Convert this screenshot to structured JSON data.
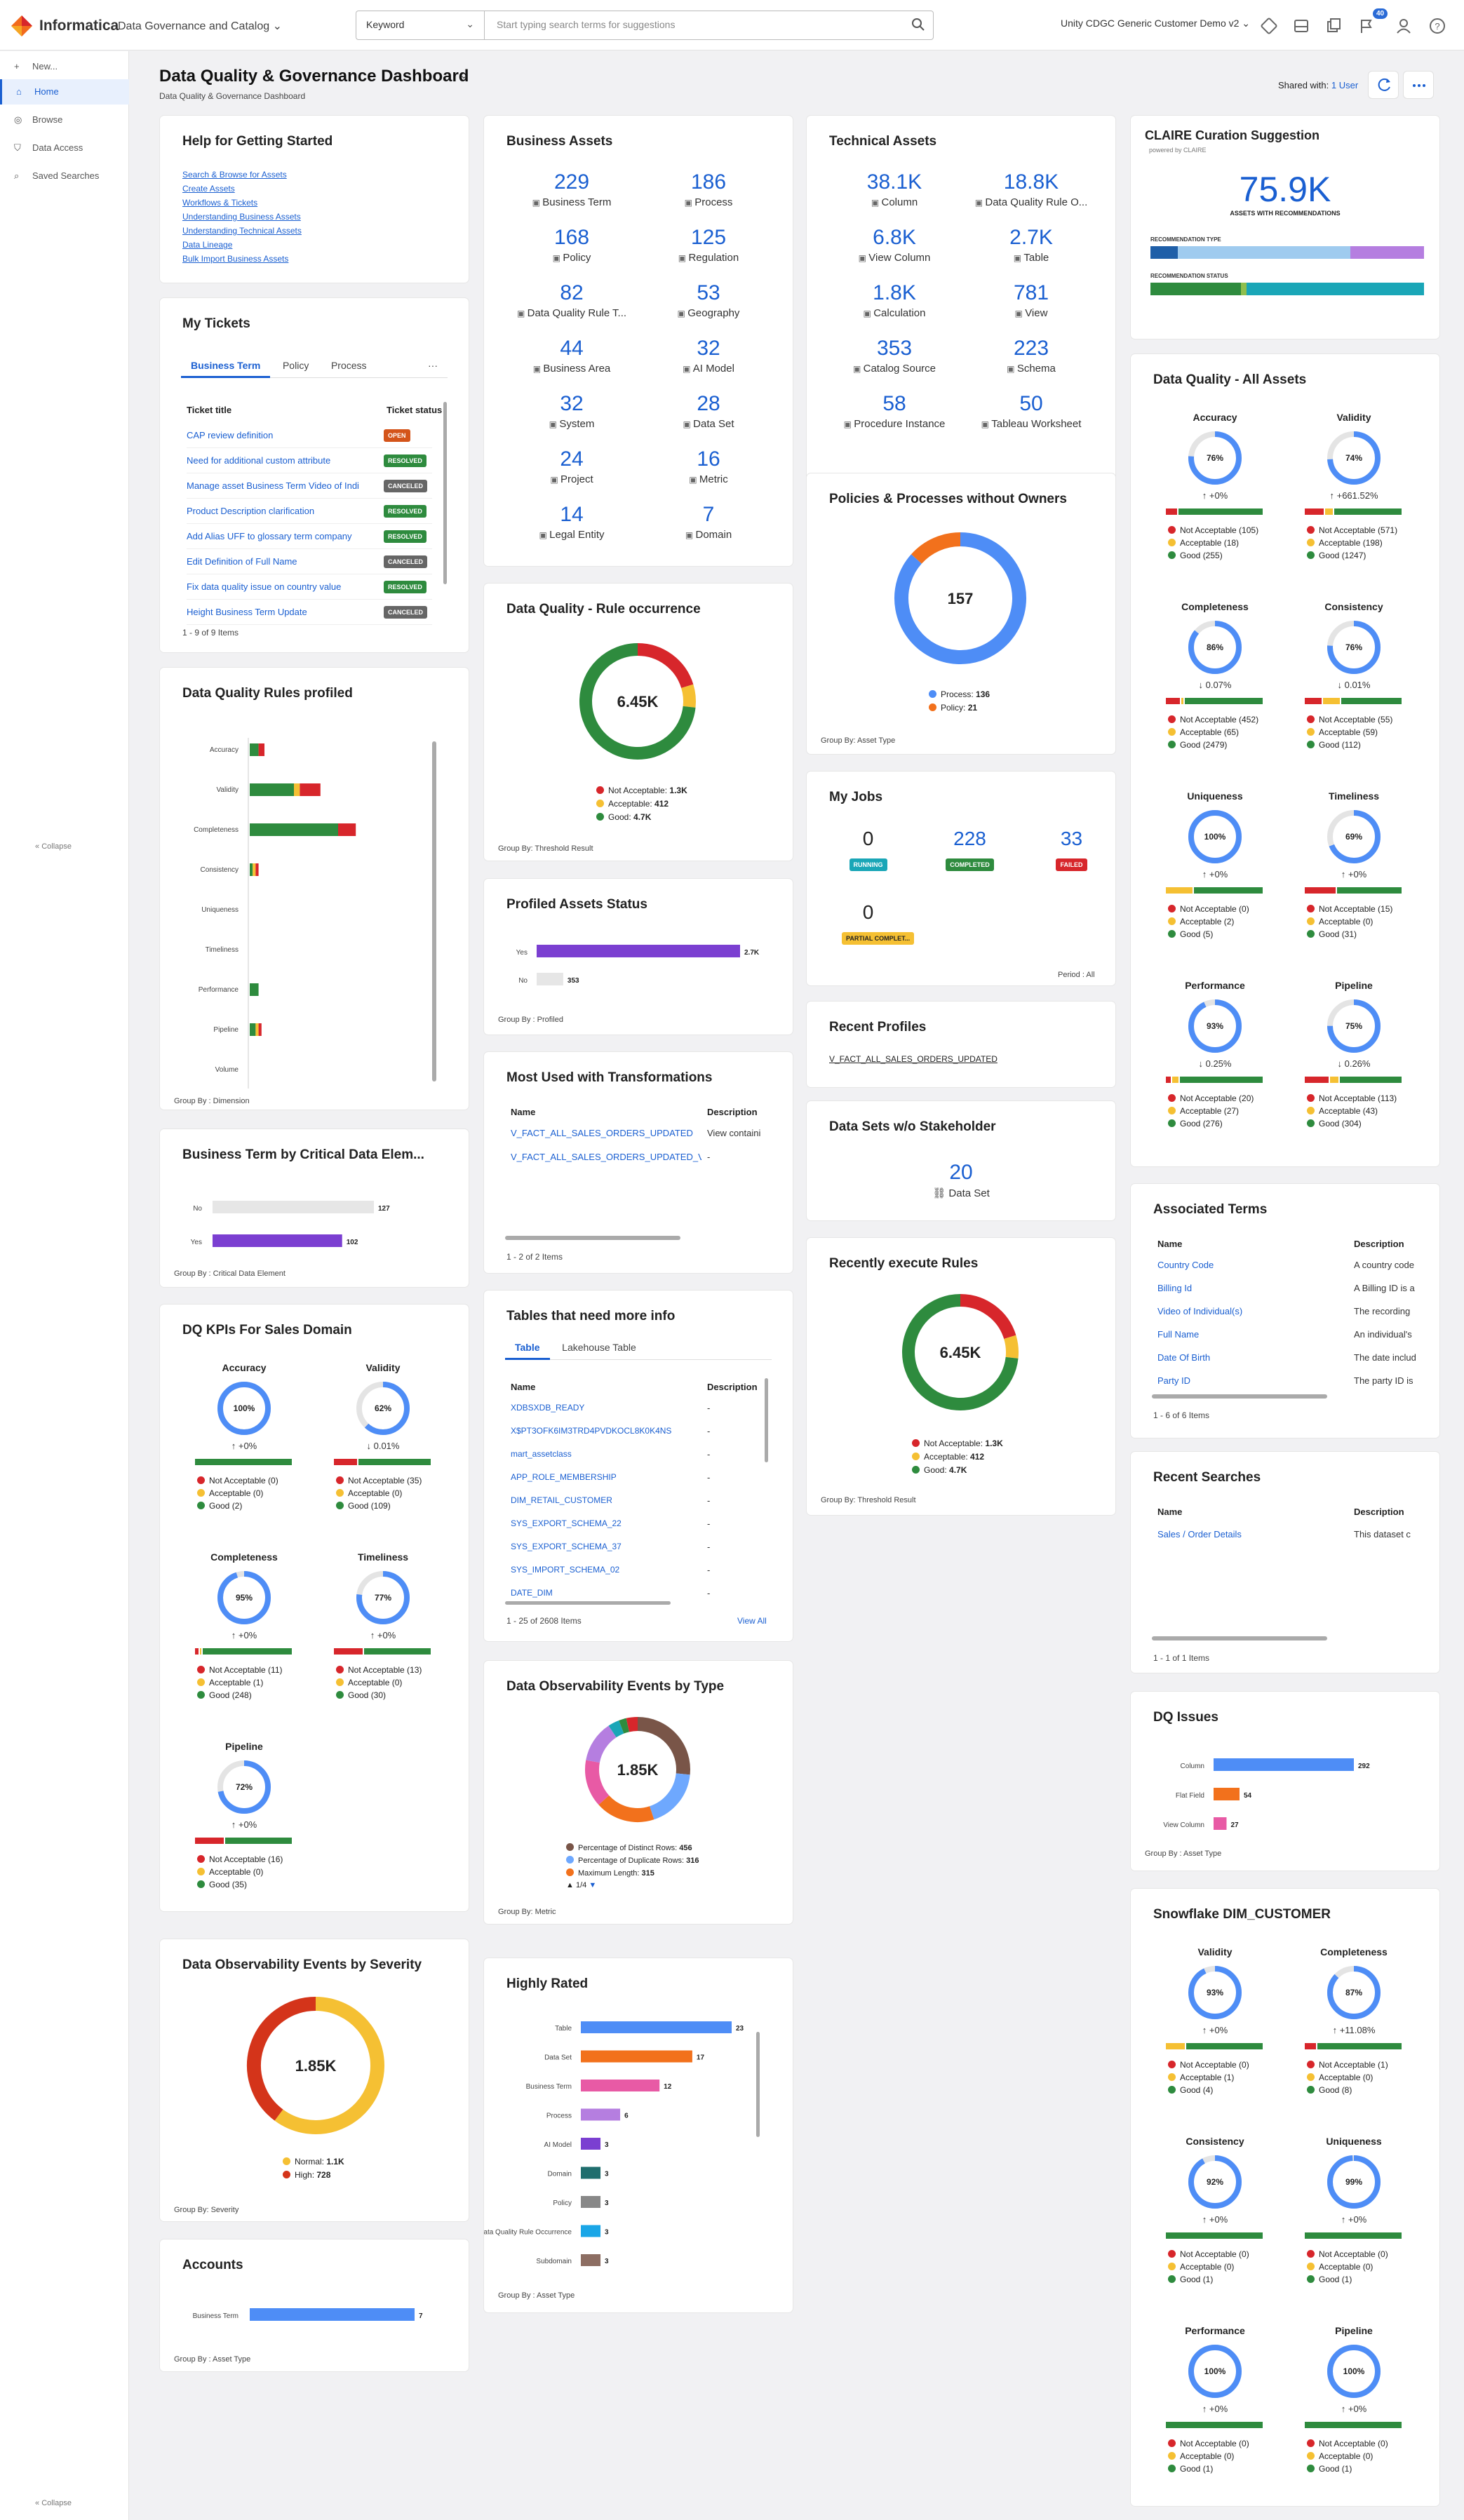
{
  "app": {
    "brand": "Informatica",
    "product": "Data Governance and Catalog",
    "search_type": "Keyword",
    "search_placeholder": "Start typing search terms for suggestions",
    "org": "Unity CDGC Generic Customer Demo v2",
    "notifications": "40"
  },
  "sidebar": {
    "items": [
      {
        "label": "New..."
      },
      {
        "label": "Home"
      },
      {
        "label": "Browse"
      },
      {
        "label": "Data Access"
      },
      {
        "label": "Saved Searches"
      }
    ],
    "collapse1": "Collapse",
    "collapse2": "Collapse"
  },
  "page": {
    "title": "Data Quality & Governance Dashboard",
    "subtitle": "Data Quality & Governance Dashboard",
    "shared_label": "Shared with:",
    "shared_value": "1 User"
  },
  "help": {
    "title": "Help for Getting Started",
    "links": [
      "Search & Browse for Assets",
      "Create Assets",
      "Workflows & Tickets",
      "Understanding Business Assets",
      "Understanding Technical Assets",
      "Data Lineage",
      "Bulk Import Business Assets"
    ]
  },
  "tickets": {
    "title": "My Tickets",
    "tabs": [
      "Business Term",
      "Policy",
      "Process"
    ],
    "more": "···",
    "col1": "Ticket title",
    "col2": "Ticket status",
    "rows": [
      {
        "t": "CAP review definition",
        "s": "OPEN",
        "c": "#d4541a"
      },
      {
        "t": "Need for additional custom attribute",
        "s": "RESOLVED",
        "c": "#2e8b3e"
      },
      {
        "t": "Manage asset Business Term Video of Indi",
        "s": "CANCELED",
        "c": "#666"
      },
      {
        "t": "Product Description clarification",
        "s": "RESOLVED",
        "c": "#2e8b3e"
      },
      {
        "t": "Add Alias UFF to glossary term company",
        "s": "RESOLVED",
        "c": "#2e8b3e"
      },
      {
        "t": "Edit Definition of Full Name",
        "s": "CANCELED",
        "c": "#666"
      },
      {
        "t": "Fix data quality issue on country value",
        "s": "RESOLVED",
        "c": "#2e8b3e"
      },
      {
        "t": "Height Business Term Update",
        "s": "CANCELED",
        "c": "#666"
      }
    ],
    "items": "1 - 9 of 9 Items"
  },
  "business_assets": {
    "title": "Business Assets",
    "items": [
      {
        "v": "229",
        "l": "Business Term"
      },
      {
        "v": "186",
        "l": "Process"
      },
      {
        "v": "168",
        "l": "Policy"
      },
      {
        "v": "125",
        "l": "Regulation"
      },
      {
        "v": "82",
        "l": "Data Quality Rule T..."
      },
      {
        "v": "53",
        "l": "Geography"
      },
      {
        "v": "44",
        "l": "Business Area"
      },
      {
        "v": "32",
        "l": "AI Model"
      },
      {
        "v": "32",
        "l": "System"
      },
      {
        "v": "28",
        "l": "Data Set"
      },
      {
        "v": "24",
        "l": "Project"
      },
      {
        "v": "16",
        "l": "Metric"
      },
      {
        "v": "14",
        "l": "Legal Entity"
      },
      {
        "v": "7",
        "l": "Domain"
      }
    ]
  },
  "technical_assets": {
    "title": "Technical Assets",
    "items": [
      {
        "v": "38.1K",
        "l": "Column"
      },
      {
        "v": "18.8K",
        "l": "Data Quality Rule O..."
      },
      {
        "v": "6.8K",
        "l": "View Column"
      },
      {
        "v": "2.7K",
        "l": "Table"
      },
      {
        "v": "1.8K",
        "l": "Calculation"
      },
      {
        "v": "781",
        "l": "View"
      },
      {
        "v": "353",
        "l": "Catalog Source"
      },
      {
        "v": "223",
        "l": "Schema"
      },
      {
        "v": "58",
        "l": "Procedure Instance"
      },
      {
        "v": "50",
        "l": "Tableau Worksheet"
      }
    ]
  },
  "claire": {
    "title": "CLAIRE Curation Suggestion",
    "powered": "powered by CLAIRE",
    "value": "75.9K",
    "caption": "ASSETS WITH RECOMMENDATIONS",
    "type_label": "RECOMMENDATION TYPE",
    "status_label": "RECOMMENDATION STATUS"
  },
  "dq_rules_profiled": {
    "title": "Data Quality Rules profiled",
    "group_by": "Group By : Dimension"
  },
  "dq_rule_occurrence": {
    "title": "Data Quality - Rule occurrence",
    "center": "6.45K",
    "group_by": "Group By: Threshold Result"
  },
  "policies_owners": {
    "title": "Policies & Processes without Owners",
    "center": "157",
    "group_by": "Group By: Asset Type"
  },
  "my_jobs": {
    "title": "My Jobs",
    "period": "Period : All",
    "jobs": [
      {
        "v": "0",
        "l": "RUNNING",
        "c": "#1aa6b7"
      },
      {
        "v": "228",
        "l": "COMPLETED",
        "c": "#2e8b3e"
      },
      {
        "v": "33",
        "l": "FAILED",
        "c": "#d7262b"
      },
      {
        "v": "0",
        "l": "PARTIAL COMPLET...",
        "c": "#f5c033"
      }
    ]
  },
  "profiled_status": {
    "title": "Profiled Assets Status",
    "group_by": "Group By : Profiled"
  },
  "recent_profiles": {
    "title": "Recent Profiles",
    "item": "V_FACT_ALL_SALES_ORDERS_UPDATED"
  },
  "most_used": {
    "title": "Most Used with Transformations",
    "col1": "Name",
    "col2": "Description",
    "rows": [
      {
        "n": "V_FACT_ALL_SALES_ORDERS_UPDATED",
        "d": "View containi"
      },
      {
        "n": "V_FACT_ALL_SALES_ORDERS_UPDATED_V",
        "d": "-"
      }
    ],
    "items": "1 - 2 of 2 Items"
  },
  "datasets_stakeholder": {
    "title": "Data Sets w/o Stakeholder",
    "value": "20",
    "label": "Data Set"
  },
  "bt_critical": {
    "title": "Business Term by Critical Data Elem...",
    "group_by": "Group By : Critical Data Element"
  },
  "tables_info": {
    "title": "Tables that need more info",
    "tabs": [
      "Table",
      "Lakehouse Table"
    ],
    "col1": "Name",
    "col2": "Description",
    "rows": [
      "XDBSXDB_READY",
      "X$PT3OFK6IM3TRD4PVDKOCL8K0K4NS",
      "mart_assetclass",
      "APP_ROLE_MEMBERSHIP",
      "DIM_RETAIL_CUSTOMER",
      "SYS_EXPORT_SCHEMA_22",
      "SYS_EXPORT_SCHEMA_37",
      "SYS_IMPORT_SCHEMA_02",
      "DATE_DIM"
    ],
    "dash": "-",
    "items": "1 - 25 of 2608 Items",
    "view_all": "View All"
  },
  "recent_rules": {
    "title": "Recently execute Rules",
    "center": "6.45K",
    "group_by": "Group By: Threshold Result"
  },
  "dq_all": {
    "title": "Data Quality - All Assets"
  },
  "assoc_terms": {
    "title": "Associated Terms",
    "col1": "Name",
    "col2": "Description",
    "rows": [
      {
        "n": "Country Code",
        "d": "A country code"
      },
      {
        "n": "Billing Id",
        "d": "A Billing ID is a"
      },
      {
        "n": "Video of Individual(s)",
        "d": "The recording"
      },
      {
        "n": "Full Name",
        "d": "An individual's"
      },
      {
        "n": "Date Of Birth",
        "d": "The date includ"
      },
      {
        "n": "Party ID",
        "d": "The party ID is"
      }
    ],
    "items": "1 - 6 of 6 Items"
  },
  "recent_searches": {
    "title": "Recent Searches",
    "col1": "Name",
    "col2": "Description",
    "rows": [
      {
        "n": "Sales / Order Details",
        "d": "This dataset c"
      }
    ],
    "items": "1 - 1 of 1 Items"
  },
  "dq_kpis": {
    "title": "DQ KPIs For Sales Domain"
  },
  "obs_type": {
    "title": "Data Observability Events by Type",
    "center": "1.85K",
    "group_by": "Group By: Metric",
    "pager": "1/4"
  },
  "dq_issues": {
    "title": "DQ Issues",
    "group_by": "Group By : Asset Type"
  },
  "snowflake": {
    "title": "Snowflake DIM_CUSTOMER"
  },
  "obs_severity": {
    "title": "Data Observability Events by Severity",
    "center": "1.85K",
    "group_by": "Group By: Severity"
  },
  "highly_rated": {
    "title": "Highly Rated",
    "group_by": "Group By : Asset Type"
  },
  "accounts": {
    "title": "Accounts",
    "group_by": "Group By : Asset Type"
  },
  "chart_data": [
    {
      "id": "dq_rules_profiled",
      "type": "bar",
      "orientation": "horizontal",
      "stacked": true,
      "categories": [
        "Accuracy",
        "Validity",
        "Completeness",
        "Consistency",
        "Uniqueness",
        "Timeliness",
        "Performance",
        "Pipeline",
        "Volume"
      ],
      "series": [
        {
          "color": "#2e8b3e",
          "values": [
            3,
            15,
            30,
            1,
            0,
            0,
            3,
            2,
            0
          ]
        },
        {
          "color": "#f5c033",
          "values": [
            0,
            2,
            0,
            1,
            0,
            0,
            0,
            1,
            0
          ]
        },
        {
          "color": "#d7262b",
          "values": [
            2,
            7,
            6,
            1,
            0,
            0,
            0,
            1,
            0
          ]
        }
      ]
    },
    {
      "id": "dq_rule_occurrence",
      "type": "pie",
      "donut": true,
      "slices": [
        {
          "label": "Not Acceptable",
          "value_text": "1.3K",
          "value": 1300,
          "color": "#d7262b"
        },
        {
          "label": "Acceptable",
          "value_text": "412",
          "value": 412,
          "color": "#f5c033"
        },
        {
          "label": "Good",
          "value_text": "4.7K",
          "value": 4700,
          "color": "#2e8b3e"
        }
      ]
    },
    {
      "id": "policies_owners",
      "type": "pie",
      "donut": true,
      "slices": [
        {
          "label": "Process",
          "value": 136,
          "color": "#4e8df6"
        },
        {
          "label": "Policy",
          "value": 21,
          "color": "#f2711c"
        }
      ]
    },
    {
      "id": "profiled_status",
      "type": "bar",
      "orientation": "horizontal",
      "categories": [
        "Yes",
        "No"
      ],
      "values": [
        2700,
        353
      ],
      "labels": [
        "2.7K",
        "353"
      ],
      "colors": [
        "#7b3fd1",
        "#e6e6e6"
      ]
    },
    {
      "id": "bt_critical",
      "type": "bar",
      "orientation": "horizontal",
      "categories": [
        "No",
        "Yes"
      ],
      "values": [
        127,
        102
      ],
      "colors": [
        "#e6e6e6",
        "#7b3fd1"
      ]
    },
    {
      "id": "recent_rules",
      "type": "pie",
      "donut": true,
      "slices": [
        {
          "label": "Not Acceptable",
          "value_text": "1.3K",
          "value": 1300,
          "color": "#d7262b"
        },
        {
          "label": "Acceptable",
          "value_text": "412",
          "value": 412,
          "color": "#f5c033"
        },
        {
          "label": "Good",
          "value_text": "4.7K",
          "value": 4700,
          "color": "#2e8b3e"
        }
      ]
    },
    {
      "id": "obs_type",
      "type": "pie",
      "donut": true,
      "legend": [
        {
          "label": "Percentage of Distinct Rows",
          "value": 456,
          "color": "#795548"
        },
        {
          "label": "Percentage of Duplicate Rows",
          "value": 316,
          "color": "#6ea8fe"
        },
        {
          "label": "Maximum Length",
          "value": 315,
          "color": "#f2711c"
        }
      ],
      "slices": [
        {
          "value": 456,
          "color": "#795548"
        },
        {
          "value": 316,
          "color": "#6ea8fe"
        },
        {
          "value": 315,
          "color": "#f2711c"
        },
        {
          "value": 250,
          "color": "#e85aa5"
        },
        {
          "value": 220,
          "color": "#b57ee0"
        },
        {
          "value": 60,
          "color": "#1aa6b7"
        },
        {
          "value": 40,
          "color": "#2e8b3e"
        },
        {
          "value": 60,
          "color": "#d7262b"
        }
      ]
    },
    {
      "id": "obs_severity",
      "type": "pie",
      "donut": true,
      "slices": [
        {
          "label": "Normal",
          "value_text": "1.1K",
          "value": 1100,
          "color": "#f5c033"
        },
        {
          "label": "High",
          "value": 728,
          "color": "#d4341a"
        }
      ]
    },
    {
      "id": "dq_issues",
      "type": "bar",
      "orientation": "horizontal",
      "categories": [
        "Column",
        "Flat Field",
        "View Column"
      ],
      "values": [
        292,
        54,
        27
      ],
      "colors": [
        "#4e8df6",
        "#f2711c",
        "#e85aa5"
      ]
    },
    {
      "id": "highly_rated",
      "type": "bar",
      "orientation": "horizontal",
      "categories": [
        "Table",
        "Data Set",
        "Business Term",
        "Process",
        "AI Model",
        "Domain",
        "Policy",
        "Data Quality Rule Occurrence",
        "Subdomain"
      ],
      "values": [
        23,
        17,
        12,
        6,
        3,
        3,
        3,
        3,
        3
      ],
      "colors": [
        "#4e8df6",
        "#f2711c",
        "#e85aa5",
        "#b57ee0",
        "#7b3fd1",
        "#1f6e6e",
        "#888888",
        "#1aa6e7",
        "#8d6e63"
      ]
    },
    {
      "id": "accounts",
      "type": "bar",
      "orientation": "horizontal",
      "categories": [
        "Business Term"
      ],
      "values": [
        7
      ],
      "colors": [
        "#4e8df6"
      ]
    }
  ],
  "dq_all_items": [
    {
      "name": "Accuracy",
      "pct": 76,
      "delta": "↑ +0%",
      "bar": [
        12,
        0,
        88
      ],
      "na": 105,
      "ac": 18,
      "gd": 255
    },
    {
      "name": "Validity",
      "pct": 74,
      "delta": "↑ +661.52%",
      "bar": [
        20,
        8,
        72
      ],
      "na": 571,
      "ac": 198,
      "gd": 1247
    },
    {
      "name": "Completeness",
      "pct": 86,
      "delta": "↓ 0.07%",
      "bar": [
        15,
        2,
        83
      ],
      "na": 452,
      "ac": 65,
      "gd": 2479
    },
    {
      "name": "Consistency",
      "pct": 76,
      "delta": "↓ 0.01%",
      "bar": [
        18,
        18,
        64
      ],
      "na": 55,
      "ac": 59,
      "gd": 112
    },
    {
      "name": "Uniqueness",
      "pct": 100,
      "delta": "↑ +0%",
      "bar": [
        0,
        28,
        72
      ],
      "na": 0,
      "ac": 2,
      "gd": 5
    },
    {
      "name": "Timeliness",
      "pct": 69,
      "delta": "↑ +0%",
      "bar": [
        32,
        0,
        68
      ],
      "na": 15,
      "ac": 0,
      "gd": 31
    },
    {
      "name": "Performance",
      "pct": 93,
      "delta": "↓ 0.25%",
      "bar": [
        5,
        7,
        88
      ],
      "na": 20,
      "ac": 27,
      "gd": 276
    },
    {
      "name": "Pipeline",
      "pct": 75,
      "delta": "↓ 0.26%",
      "bar": [
        25,
        9,
        66
      ],
      "na": 113,
      "ac": 43,
      "gd": 304
    }
  ],
  "dq_kpi_items": [
    {
      "name": "Accuracy",
      "pct": 100,
      "delta": "↑ +0%",
      "bar": [
        0,
        0,
        100
      ],
      "na": 0,
      "ac": 0,
      "gd": 2
    },
    {
      "name": "Validity",
      "pct": 62,
      "delta": "↓ 0.01%",
      "bar": [
        24,
        0,
        76
      ],
      "na": 35,
      "ac": 0,
      "gd": 109
    },
    {
      "name": "Completeness",
      "pct": 95,
      "delta": "↑ +0%",
      "bar": [
        4,
        1,
        95
      ],
      "na": 11,
      "ac": 1,
      "gd": 248
    },
    {
      "name": "Timeliness",
      "pct": 77,
      "delta": "↑ +0%",
      "bar": [
        30,
        0,
        70
      ],
      "na": 13,
      "ac": 0,
      "gd": 30
    },
    {
      "name": "Pipeline",
      "pct": 72,
      "delta": "↑ +0%",
      "bar": [
        30,
        0,
        70
      ],
      "na": 16,
      "ac": 0,
      "gd": 35
    }
  ],
  "snowflake_items": [
    {
      "name": "Validity",
      "pct": 93,
      "delta": "↑ +0%",
      "bar": [
        0,
        20,
        80
      ],
      "na": 0,
      "ac": 1,
      "gd": 4
    },
    {
      "name": "Completeness",
      "pct": 87,
      "delta": "↑ +11.08%",
      "bar": [
        12,
        0,
        88
      ],
      "na": 1,
      "ac": 0,
      "gd": 8
    },
    {
      "name": "Consistency",
      "pct": 92,
      "delta": "↑ +0%",
      "bar": [
        0,
        0,
        100
      ],
      "na": 0,
      "ac": 0,
      "gd": 1
    },
    {
      "name": "Uniqueness",
      "pct": 99,
      "delta": "↑ +0%",
      "bar": [
        0,
        0,
        100
      ],
      "na": 0,
      "ac": 0,
      "gd": 1
    },
    {
      "name": "Performance",
      "pct": 100,
      "delta": "↑ +0%",
      "bar": [
        0,
        0,
        100
      ],
      "na": 0,
      "ac": 0,
      "gd": 1
    },
    {
      "name": "Pipeline",
      "pct": 100,
      "delta": "↑ +0%",
      "bar": [
        0,
        0,
        100
      ],
      "na": 0,
      "ac": 0,
      "gd": 1
    }
  ],
  "legend_labels": {
    "na": "Not Acceptable",
    "ac": "Acceptable",
    "gd": "Good",
    "process": "Process",
    "policy": "Policy",
    "normal": "Normal",
    "high": "High"
  },
  "claire_bars": {
    "type": [
      {
        "color": "#1f5fa8",
        "value": 10
      },
      {
        "color": "#9fcbef",
        "value": 63
      },
      {
        "color": "#b57ee0",
        "value": 27
      }
    ],
    "status": [
      {
        "color": "#2e8b3e",
        "value": 33
      },
      {
        "color": "#8fbf4e",
        "value": 2
      },
      {
        "color": "#1aa6b7",
        "value": 65
      }
    ]
  },
  "colors": {
    "accent": "#1a5fd1",
    "na": "#d7262b",
    "ac": "#f5c033",
    "gd": "#2e8b3e",
    "ring": "#4e8df6"
  }
}
